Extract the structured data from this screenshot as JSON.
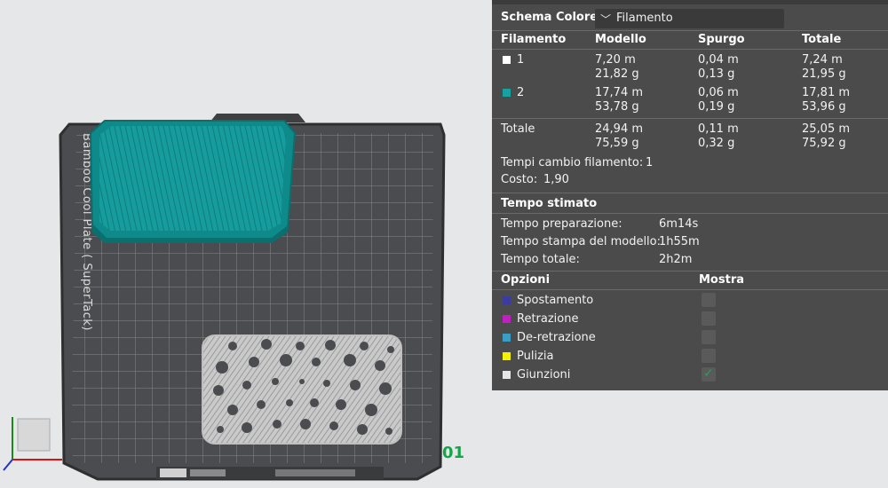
{
  "plate": {
    "name": "Bamboo Cool Plate ( SuperTack)",
    "number": "01"
  },
  "panel": {
    "color_scheme": {
      "label": "Schema Colore",
      "value": "Filamento",
      "chevron_icon": "chevron-down-icon"
    },
    "table_headers": {
      "filament": "Filamento",
      "model": "Modello",
      "purge": "Spurgo",
      "total": "Totale"
    },
    "filaments": [
      {
        "id": "1",
        "color": "#ffffff",
        "model_len": "7,20 m",
        "model_weight": "21,82 g",
        "purge_len": "0,04 m",
        "purge_weight": "0,13 g",
        "total_len": "7,24 m",
        "total_weight": "21,95 g"
      },
      {
        "id": "2",
        "color": "#17a2a2",
        "model_len": "17,74 m",
        "model_weight": "53,78 g",
        "purge_len": "0,06 m",
        "purge_weight": "0,19 g",
        "total_len": "17,81 m",
        "total_weight": "53,96 g"
      }
    ],
    "totals": {
      "label": "Totale",
      "model_len": "24,94 m",
      "model_weight": "75,59 g",
      "purge_len": "0,11 m",
      "purge_weight": "0,32 g",
      "total_len": "25,05 m",
      "total_weight": "75,92 g"
    },
    "filament_changes": {
      "label": "Tempi cambio filamento:",
      "value": "1"
    },
    "cost": {
      "label": "Costo:",
      "value": "1,90"
    },
    "estimated_time": {
      "heading": "Tempo stimato",
      "rows": [
        {
          "label": "Tempo preparazione:",
          "value": "6m14s"
        },
        {
          "label": "Tempo stampa del modello:",
          "value": "1h55m"
        },
        {
          "label": "Tempo totale:",
          "value": "2h2m"
        }
      ]
    },
    "options": {
      "heading": "Opzioni",
      "show_heading": "Mostra",
      "items": [
        {
          "label": "Spostamento",
          "color": "#3c3c9e",
          "checked": false
        },
        {
          "label": "Retrazione",
          "color": "#c21fc2",
          "checked": false
        },
        {
          "label": "De-retrazione",
          "color": "#3a9ec4",
          "checked": false
        },
        {
          "label": "Pulizia",
          "color": "#f2f200",
          "checked": false
        },
        {
          "label": "Giunzioni",
          "color": "#e6e6e6",
          "checked": true
        }
      ]
    }
  },
  "colors": {
    "model_teal": "#17a2a2",
    "plate_number": "#16a34a"
  }
}
